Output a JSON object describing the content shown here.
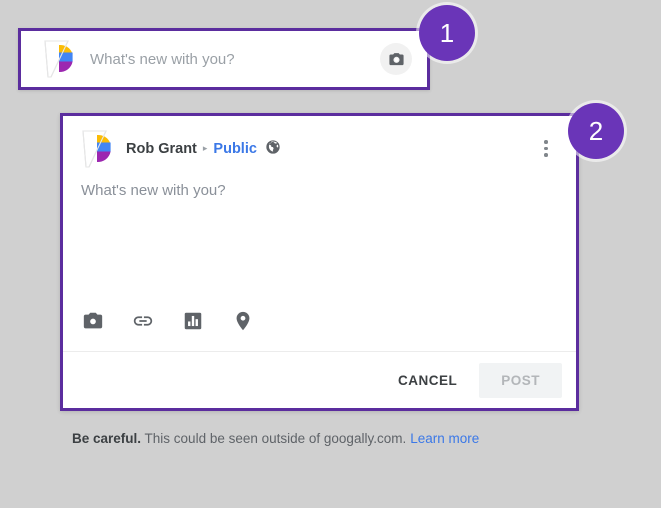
{
  "page": {
    "background_color": "#d0d0d0",
    "accent_color": "#5b2d9e",
    "badge_color": "#6a35b8",
    "link_color": "#3b78e7"
  },
  "annotations": [
    {
      "number": "1",
      "name": "annotation-badge-1"
    },
    {
      "number": "2",
      "name": "annotation-badge-2"
    }
  ],
  "composer_collapsed": {
    "avatar_icon": "google-plus-profile-avatar",
    "placeholder": "What's new with you?",
    "camera_button_icon": "camera-icon"
  },
  "composer_expanded": {
    "avatar_icon": "google-plus-profile-avatar",
    "author_name": "Rob Grant",
    "separator": "▸",
    "audience": "Public",
    "audience_icon": "globe-icon",
    "menu_icon": "more-vert-icon",
    "body_placeholder": "What's new with you?",
    "attachments": [
      {
        "name": "attach-photo-button",
        "icon": "camera-icon"
      },
      {
        "name": "attach-link-button",
        "icon": "link-icon"
      },
      {
        "name": "attach-poll-button",
        "icon": "poll-bar-chart-icon"
      },
      {
        "name": "attach-location-button",
        "icon": "location-pin-icon"
      }
    ],
    "cancel_label": "CANCEL",
    "post_label": "POST",
    "post_enabled": false
  },
  "footer_notice": {
    "bold_prefix": "Be careful.",
    "message": "This could be seen outside of googally.com.",
    "link_label": "Learn more"
  }
}
